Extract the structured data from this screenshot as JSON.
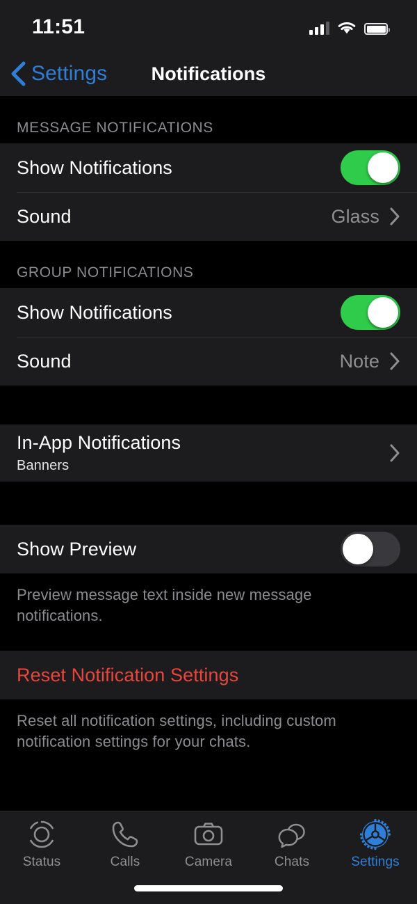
{
  "status_bar": {
    "time": "11:51",
    "cellular_icon": "cellular-bars-icon",
    "wifi_icon": "wifi-icon",
    "battery_icon": "battery-full-icon"
  },
  "nav": {
    "back_label": "Settings",
    "back_icon": "chevron-left-icon",
    "title": "Notifications"
  },
  "sections": {
    "message": {
      "header": "MESSAGE NOTIFICATIONS",
      "show_notifications_label": "Show Notifications",
      "show_notifications_value": "on",
      "sound_label": "Sound",
      "sound_value": "Glass"
    },
    "group": {
      "header": "GROUP NOTIFICATIONS",
      "show_notifications_label": "Show Notifications",
      "show_notifications_value": "on",
      "sound_label": "Sound",
      "sound_value": "Note"
    },
    "in_app": {
      "label": "In-App Notifications",
      "sub": "Banners"
    },
    "preview": {
      "label": "Show Preview",
      "value": "off",
      "footer": "Preview message text inside new message notifications."
    },
    "reset": {
      "label": "Reset Notification Settings",
      "footer": "Reset all notification settings, including custom notification settings for your chats."
    }
  },
  "tabbar": {
    "items": [
      {
        "label": "Status",
        "icon": "status-rings-icon",
        "active": false
      },
      {
        "label": "Calls",
        "icon": "phone-icon",
        "active": false
      },
      {
        "label": "Camera",
        "icon": "camera-icon",
        "active": false
      },
      {
        "label": "Chats",
        "icon": "chat-bubbles-icon",
        "active": false
      },
      {
        "label": "Settings",
        "icon": "gear-icon",
        "active": true
      }
    ]
  },
  "colors": {
    "accent_blue": "#2f7fd8",
    "toggle_on_green": "#2ecc4a",
    "toggle_off_gray": "#39393d",
    "destructive_red": "#e8453c",
    "card_bg": "#1c1c1e",
    "page_bg": "#000000",
    "secondary_text": "#8e8e93"
  }
}
